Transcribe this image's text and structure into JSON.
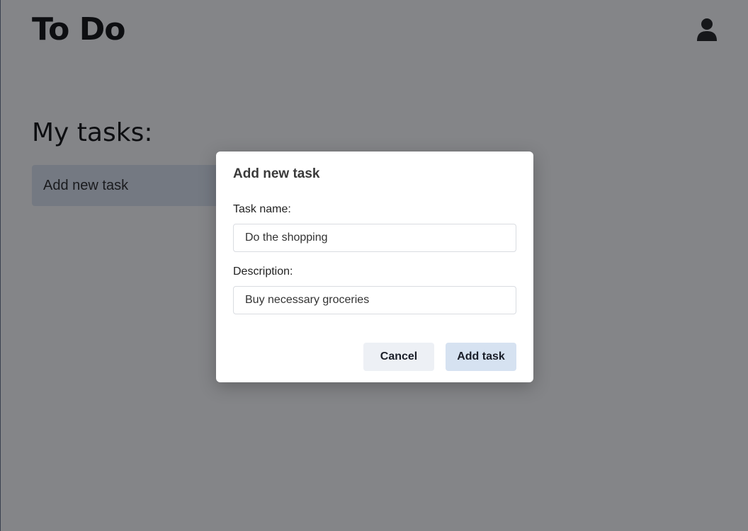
{
  "header": {
    "app_title": "To Do",
    "user_icon": "user-icon"
  },
  "main": {
    "section_title": "My tasks:",
    "add_task_label": "Add new task"
  },
  "modal": {
    "title": "Add new task",
    "task_name": {
      "label": "Task name:",
      "value": "Do the shopping"
    },
    "description": {
      "label": "Description:",
      "value": "Buy necessary groceries"
    },
    "cancel_label": "Cancel",
    "submit_label": "Add task"
  },
  "colors": {
    "overlay": "#87888a",
    "modal_background": "#ffffff",
    "cancel_button": "#edf0f5",
    "submit_button": "#d6e2f1",
    "add_task_bar": "#dfe7f3"
  }
}
